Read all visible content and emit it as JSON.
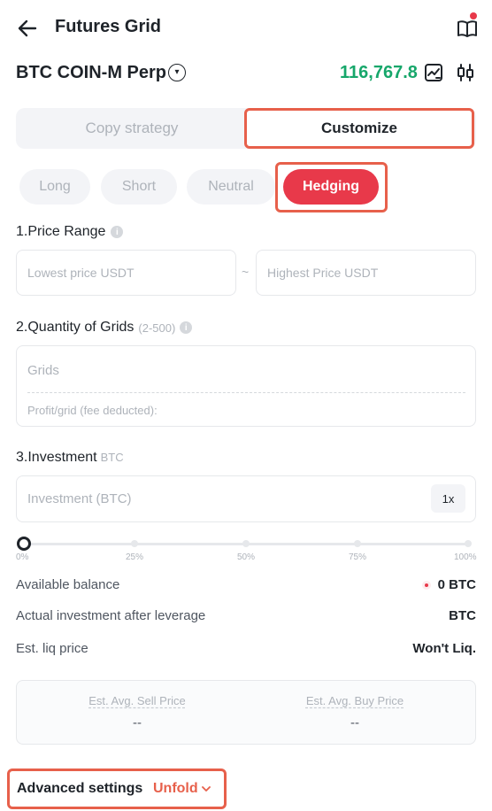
{
  "header": {
    "title": "Futures Grid",
    "back_icon": "arrow-left-icon",
    "guide_icon": "book-open-icon"
  },
  "pair": {
    "name": "BTC COIN-M Perp",
    "price": "116,767.8",
    "price_color": "#17a76b"
  },
  "mode_tabs": [
    {
      "label": "Copy strategy",
      "active": false
    },
    {
      "label": "Customize",
      "active": true
    }
  ],
  "direction_tabs": [
    {
      "label": "Long",
      "active": false
    },
    {
      "label": "Short",
      "active": false
    },
    {
      "label": "Neutral",
      "active": false
    },
    {
      "label": "Hedging",
      "active": true
    }
  ],
  "price_range": {
    "label": "1.Price Range",
    "lowest_placeholder": "Lowest price USDT",
    "separator": "~",
    "highest_placeholder": "Highest Price USDT"
  },
  "grids": {
    "label": "2.Quantity of Grids",
    "range_hint": "(2-500)",
    "placeholder": "Grids",
    "profit_label": "Profit/grid (fee deducted):"
  },
  "investment": {
    "label": "3.Investment",
    "unit": "BTC",
    "placeholder": "Investment (BTC)",
    "leverage": "1x",
    "slider_percent": 0,
    "slider_ticks": [
      "0%",
      "25%",
      "50%",
      "75%",
      "100%"
    ]
  },
  "info_rows": [
    {
      "label": "Available balance",
      "value": "0 BTC"
    },
    {
      "label": "Actual investment after leverage",
      "value": "BTC"
    },
    {
      "label": "Est. liq price",
      "value": "Won't Liq."
    }
  ],
  "estimates": {
    "sell_label": "Est. Avg. Sell Price",
    "sell_value": "--",
    "buy_label": "Est. Avg. Buy Price",
    "buy_value": "--"
  },
  "advanced": {
    "label": "Advanced settings",
    "toggle": "Unfold"
  },
  "colors": {
    "accent": "#e8394a",
    "highlight_frame": "#e7604b",
    "positive": "#17a76b"
  }
}
